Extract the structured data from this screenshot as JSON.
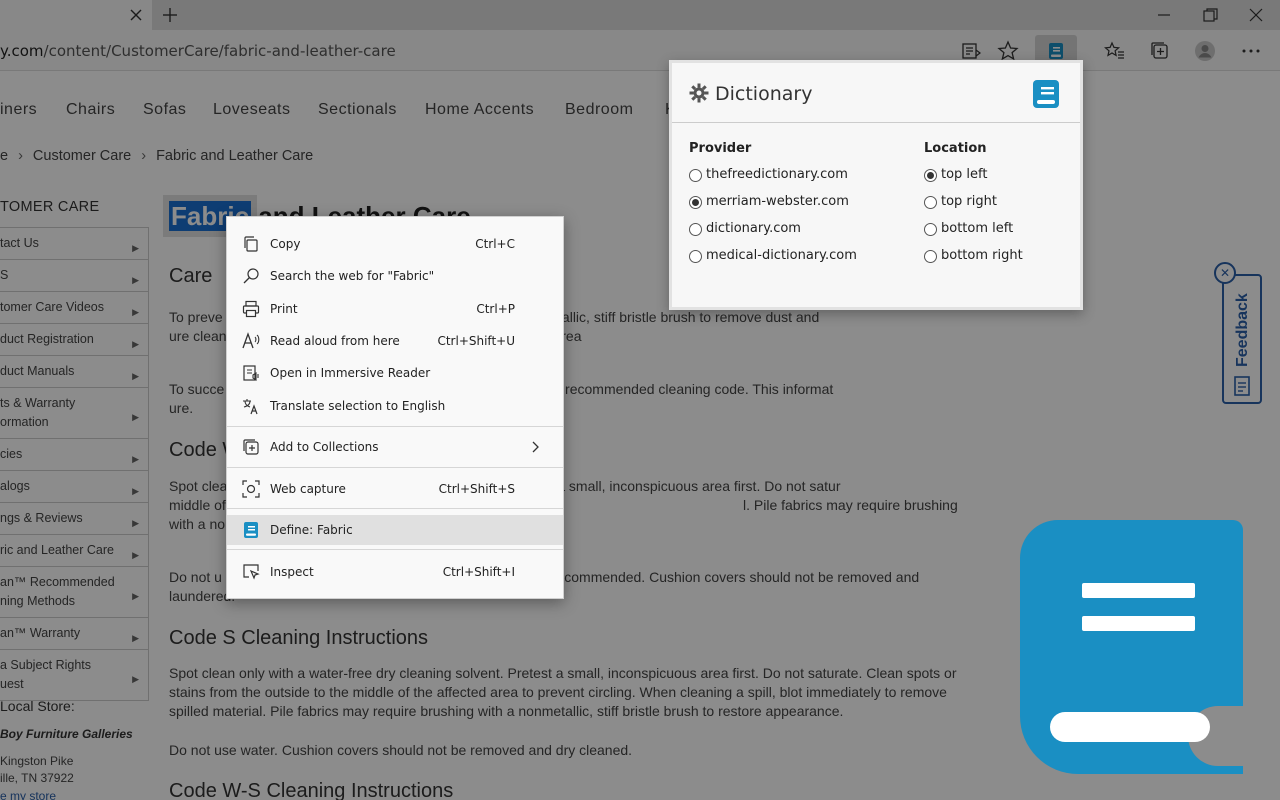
{
  "browser": {
    "url_prefix": "y.com",
    "url_path": "/content/CustomerCare/fabric-and-leather-care"
  },
  "site": {
    "nav": [
      "iners",
      "Chairs",
      "Sofas",
      "Loveseats",
      "Sectionals",
      "Home Accents",
      "Bedroom",
      "K"
    ],
    "breadcrumb": [
      "e",
      "Customer Care",
      "Fabric and Leather Care"
    ],
    "sidebar_title": "TOMER CARE",
    "sidebar_items": [
      "tact Us",
      "S",
      "tomer Care Videos",
      "duct Registration",
      "duct Manuals",
      "ts & Warranty\normation",
      "cies",
      "alogs",
      "ngs & Reviews",
      "ric and Leather Care",
      "an™ Recommended\nning Methods",
      "an™ Warranty",
      "a Subject Rights\nuest"
    ],
    "store_title": "Local Store:",
    "store_name": "Boy Furniture Galleries",
    "store_address": [
      "Kingston Pike",
      "ille, TN 37922",
      "e my store"
    ],
    "page_title_selected": "Fabric",
    "page_title_rest": " and Leather Care",
    "section1_heading": "Care",
    "p1": "To preve                                                  brushing with a nonmetallic, stiff bristle brush to remove dust and                                                  ure cleaning service when an overall soiled condition has been rea",
    "p2": "To succe                                                  e type of fabric and the recommended cleaning code. This informat                                                  ure.",
    "section2_heading": "Code W",
    "p3": "Spot clea                                                  stery cleaner. Pretest a small, inconspicuous area first. Do not satur                                                  middle of the affected area to prevent circling. When cleaning                                                  l. Pile fabrics may require brushing with a nonmetallic, stiff bristle br",
    "p4": "Do not u                                                  steam cleaning is not recommended. Cushion covers should not be removed and laundered.",
    "section3_heading": "Code S Cleaning Instructions",
    "p5": "Spot clean only with a water-free dry cleaning solvent. Pretest a small, inconspicuous area first. Do not saturate. Clean spots or stains from the outside to the middle of the affected area to prevent circling. When cleaning a spill, blot immediately to remove spilled material. Pile fabrics may require brushing with a nonmetallic, stiff bristle brush to restore appearance.",
    "p6": "Do not use water. Cushion covers should not be removed and dry cleaned.",
    "section4_heading": "Code W-S Cleaning Instructions",
    "feedback_label": "Feedback"
  },
  "context_menu": {
    "items": [
      {
        "label": "Copy",
        "shortcut": "Ctrl+C",
        "icon": "copy-icon"
      },
      {
        "label": "Search the web for \"Fabric\"",
        "shortcut": "",
        "icon": "search-icon"
      },
      {
        "label": "Print",
        "shortcut": "Ctrl+P",
        "icon": "print-icon"
      },
      {
        "label": "Read aloud from here",
        "shortcut": "Ctrl+Shift+U",
        "icon": "read-aloud-icon"
      },
      {
        "label": "Open in Immersive Reader",
        "shortcut": "",
        "icon": "immersive-reader-icon"
      },
      {
        "label": "Translate selection to English",
        "shortcut": "",
        "icon": "translate-icon"
      },
      {
        "label": "Add to Collections",
        "shortcut": "",
        "icon": "collections-icon"
      },
      {
        "label": "Web capture",
        "shortcut": "Ctrl+Shift+S",
        "icon": "web-capture-icon"
      },
      {
        "label": "Define: Fabric",
        "shortcut": "",
        "icon": "dictionary-icon"
      },
      {
        "label": "Inspect",
        "shortcut": "Ctrl+Shift+I",
        "icon": "inspect-icon"
      }
    ]
  },
  "dictionary_popup": {
    "title": "Dictionary",
    "provider_heading": "Provider",
    "location_heading": "Location",
    "providers": [
      "thefreedictionary.com",
      "merriam-webster.com",
      "dictionary.com",
      "medical-dictionary.com"
    ],
    "selected_provider": "merriam-webster.com",
    "locations": [
      "top left",
      "top right",
      "bottom left",
      "bottom right"
    ],
    "selected_location": "top left",
    "accent_color": "#1a8fc3"
  }
}
